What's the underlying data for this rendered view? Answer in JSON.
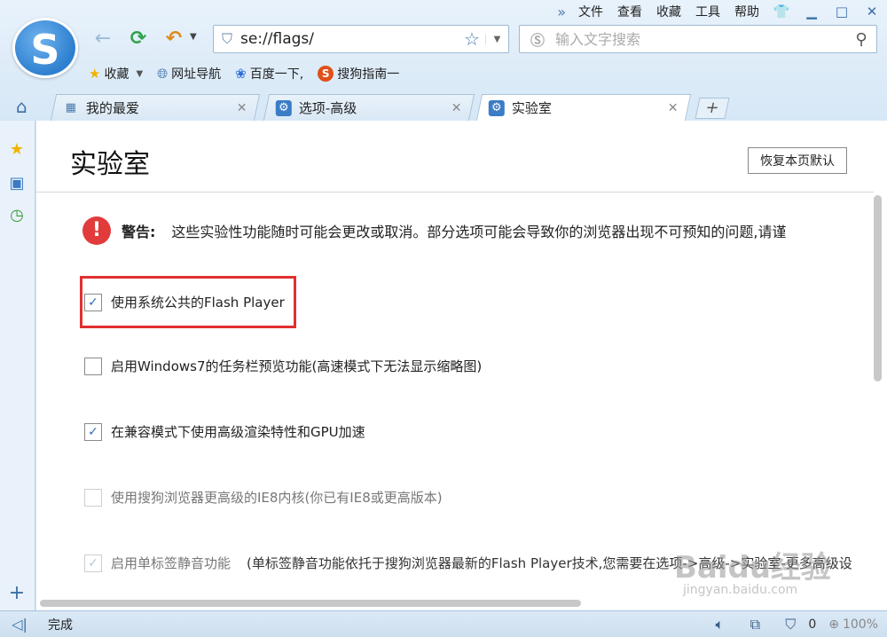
{
  "menubar": {
    "items": [
      "文件",
      "查看",
      "收藏",
      "工具",
      "帮助"
    ],
    "overflow_icon": "double-chevron-right-icon",
    "window_buttons": [
      "skin-icon",
      "minimize-icon",
      "maximize-icon",
      "close-icon"
    ]
  },
  "address": {
    "url": "se://flags/"
  },
  "search": {
    "placeholder": "输入文字搜索"
  },
  "bookmarks": {
    "items": [
      "收藏",
      "网址导航",
      "百度一下,",
      "搜狗指南一"
    ]
  },
  "tabs": [
    {
      "label": "我的最爱",
      "icon": "grid-icon"
    },
    {
      "label": "选项-高级",
      "icon": "gear-icon"
    },
    {
      "label": "实验室",
      "icon": "gear-icon",
      "active": true
    }
  ],
  "page": {
    "title": "实验室",
    "reset_button": "恢复本页默认",
    "warning_label": "警告:",
    "warning_text": "这些实验性功能随时可能会更改或取消。部分选项可能会导致你的浏览器出现不可预知的问题,请谨",
    "options": [
      {
        "label": "使用系统公共的Flash Player",
        "checked": true,
        "disabled": false
      },
      {
        "label": "启用Windows7的任务栏预览功能(高速模式下无法显示缩略图)",
        "checked": false,
        "disabled": false
      },
      {
        "label": "在兼容模式下使用高级渲染特性和GPU加速",
        "checked": true,
        "disabled": false
      },
      {
        "label": "使用搜狗浏览器更高级的IE8内核(你已有IE8或更高版本)",
        "checked": false,
        "disabled": true
      },
      {
        "label": "启用单标签静音功能",
        "note": "(单标签静音功能依托于搜狗浏览器最新的Flash Player技术,您需要在选项->高级->实验室-更多高级设",
        "checked": true,
        "disabled": true
      }
    ]
  },
  "status": {
    "text": "完成",
    "ad_count": "0",
    "zoom": "100%"
  },
  "watermark": {
    "main": "Baidu经验",
    "sub": "jingyan.baidu.com"
  },
  "colors": {
    "highlight": "#e03030",
    "accent": "#3b7cc6",
    "warning": "#e23b3b"
  }
}
